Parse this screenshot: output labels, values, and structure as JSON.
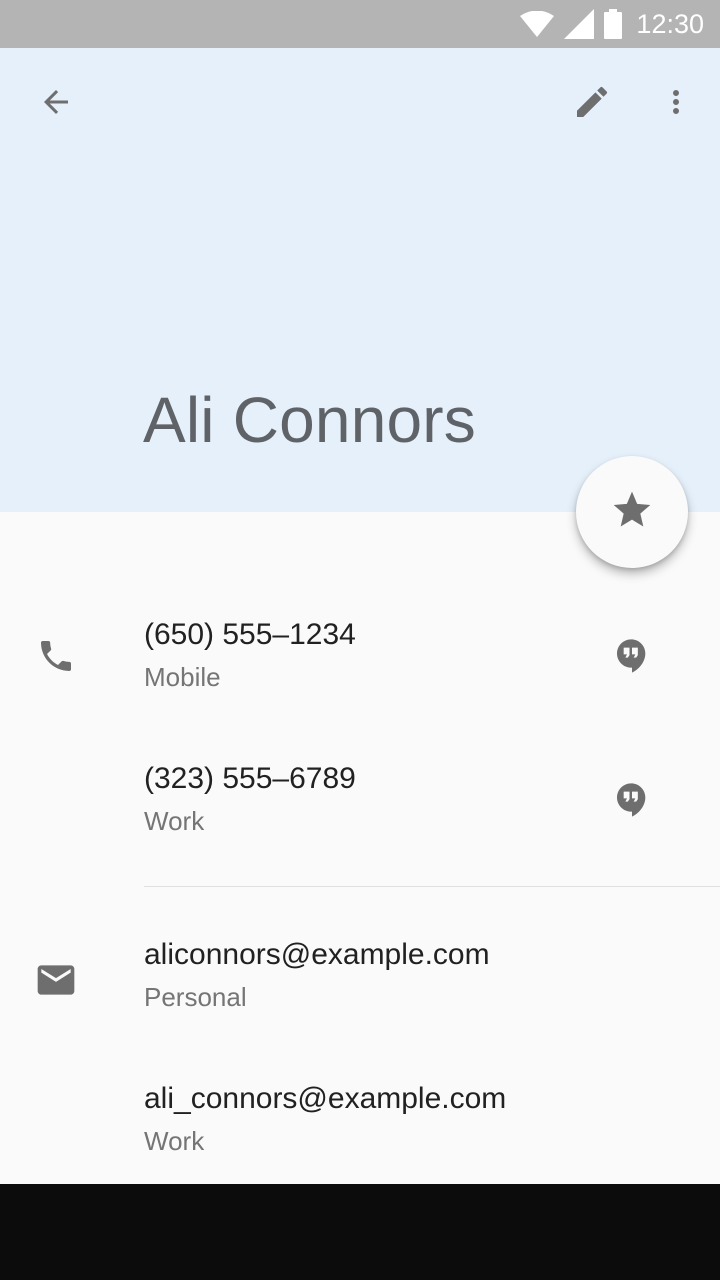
{
  "status_bar": {
    "time": "12:30",
    "icons": [
      "wifi-icon",
      "signal-icon",
      "battery-icon"
    ]
  },
  "header": {
    "contact_name": "Ali Connors",
    "background_color": "#e5f0fa",
    "icons": [
      "arrow-back-icon",
      "edit-icon",
      "more-vert-icon"
    ]
  },
  "fab": {
    "icon": "star-icon"
  },
  "phones": [
    {
      "number": "(650) 555–1234",
      "type": "Mobile",
      "action_icon": "hangouts-icon"
    },
    {
      "number": "(323) 555–6789",
      "type": "Work",
      "action_icon": "hangouts-icon"
    }
  ],
  "emails": [
    {
      "address": "aliconnors@example.com",
      "type": "Personal"
    },
    {
      "address": "ali_connors@example.com",
      "type": "Work"
    }
  ],
  "section_icons": {
    "phone": "phone-icon",
    "email": "email-icon"
  },
  "colors": {
    "icon_gray": "#6e6e6e",
    "status_bar": "#b4b4b4"
  }
}
